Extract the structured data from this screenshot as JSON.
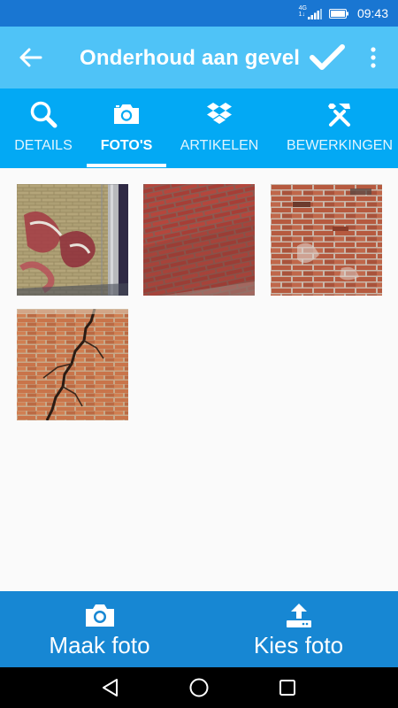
{
  "status_bar": {
    "time": "09:43",
    "network": "4G",
    "network_sub": "1↓"
  },
  "toolbar": {
    "title": "Onderhoud aan gevel",
    "back_icon": "arrow-left-icon",
    "confirm_icon": "check-icon",
    "overflow_icon": "more-vert-icon",
    "background": "#4fc3f7"
  },
  "tabs": [
    {
      "label": "DETAILS",
      "icon": "search-icon",
      "active": false
    },
    {
      "label": "FOTO'S",
      "icon": "camera-icon",
      "active": true
    },
    {
      "label": "ARTIKELEN",
      "icon": "dropbox-icon",
      "active": false
    },
    {
      "label": "BEWERKINGEN",
      "icon": "tools-icon",
      "active": false
    }
  ],
  "photos": [
    {
      "subject": "graffiti-brick-wall"
    },
    {
      "subject": "red-brick-wall"
    },
    {
      "subject": "weathered-brick-wall"
    },
    {
      "subject": "cracked-brick-wall"
    }
  ],
  "bottom_actions": {
    "take_photo": {
      "label": "Maak foto",
      "icon": "camera-icon"
    },
    "choose_photo": {
      "label": "Kies foto",
      "icon": "upload-icon"
    }
  },
  "nav": {
    "back_icon": "nav-back-icon",
    "home_icon": "nav-home-icon",
    "recents_icon": "nav-recents-icon"
  },
  "colors": {
    "status_bar": "#1976d2",
    "tab_bar": "#03a9f4",
    "bottom_bar": "#1787d3",
    "content": "#fafafa"
  }
}
